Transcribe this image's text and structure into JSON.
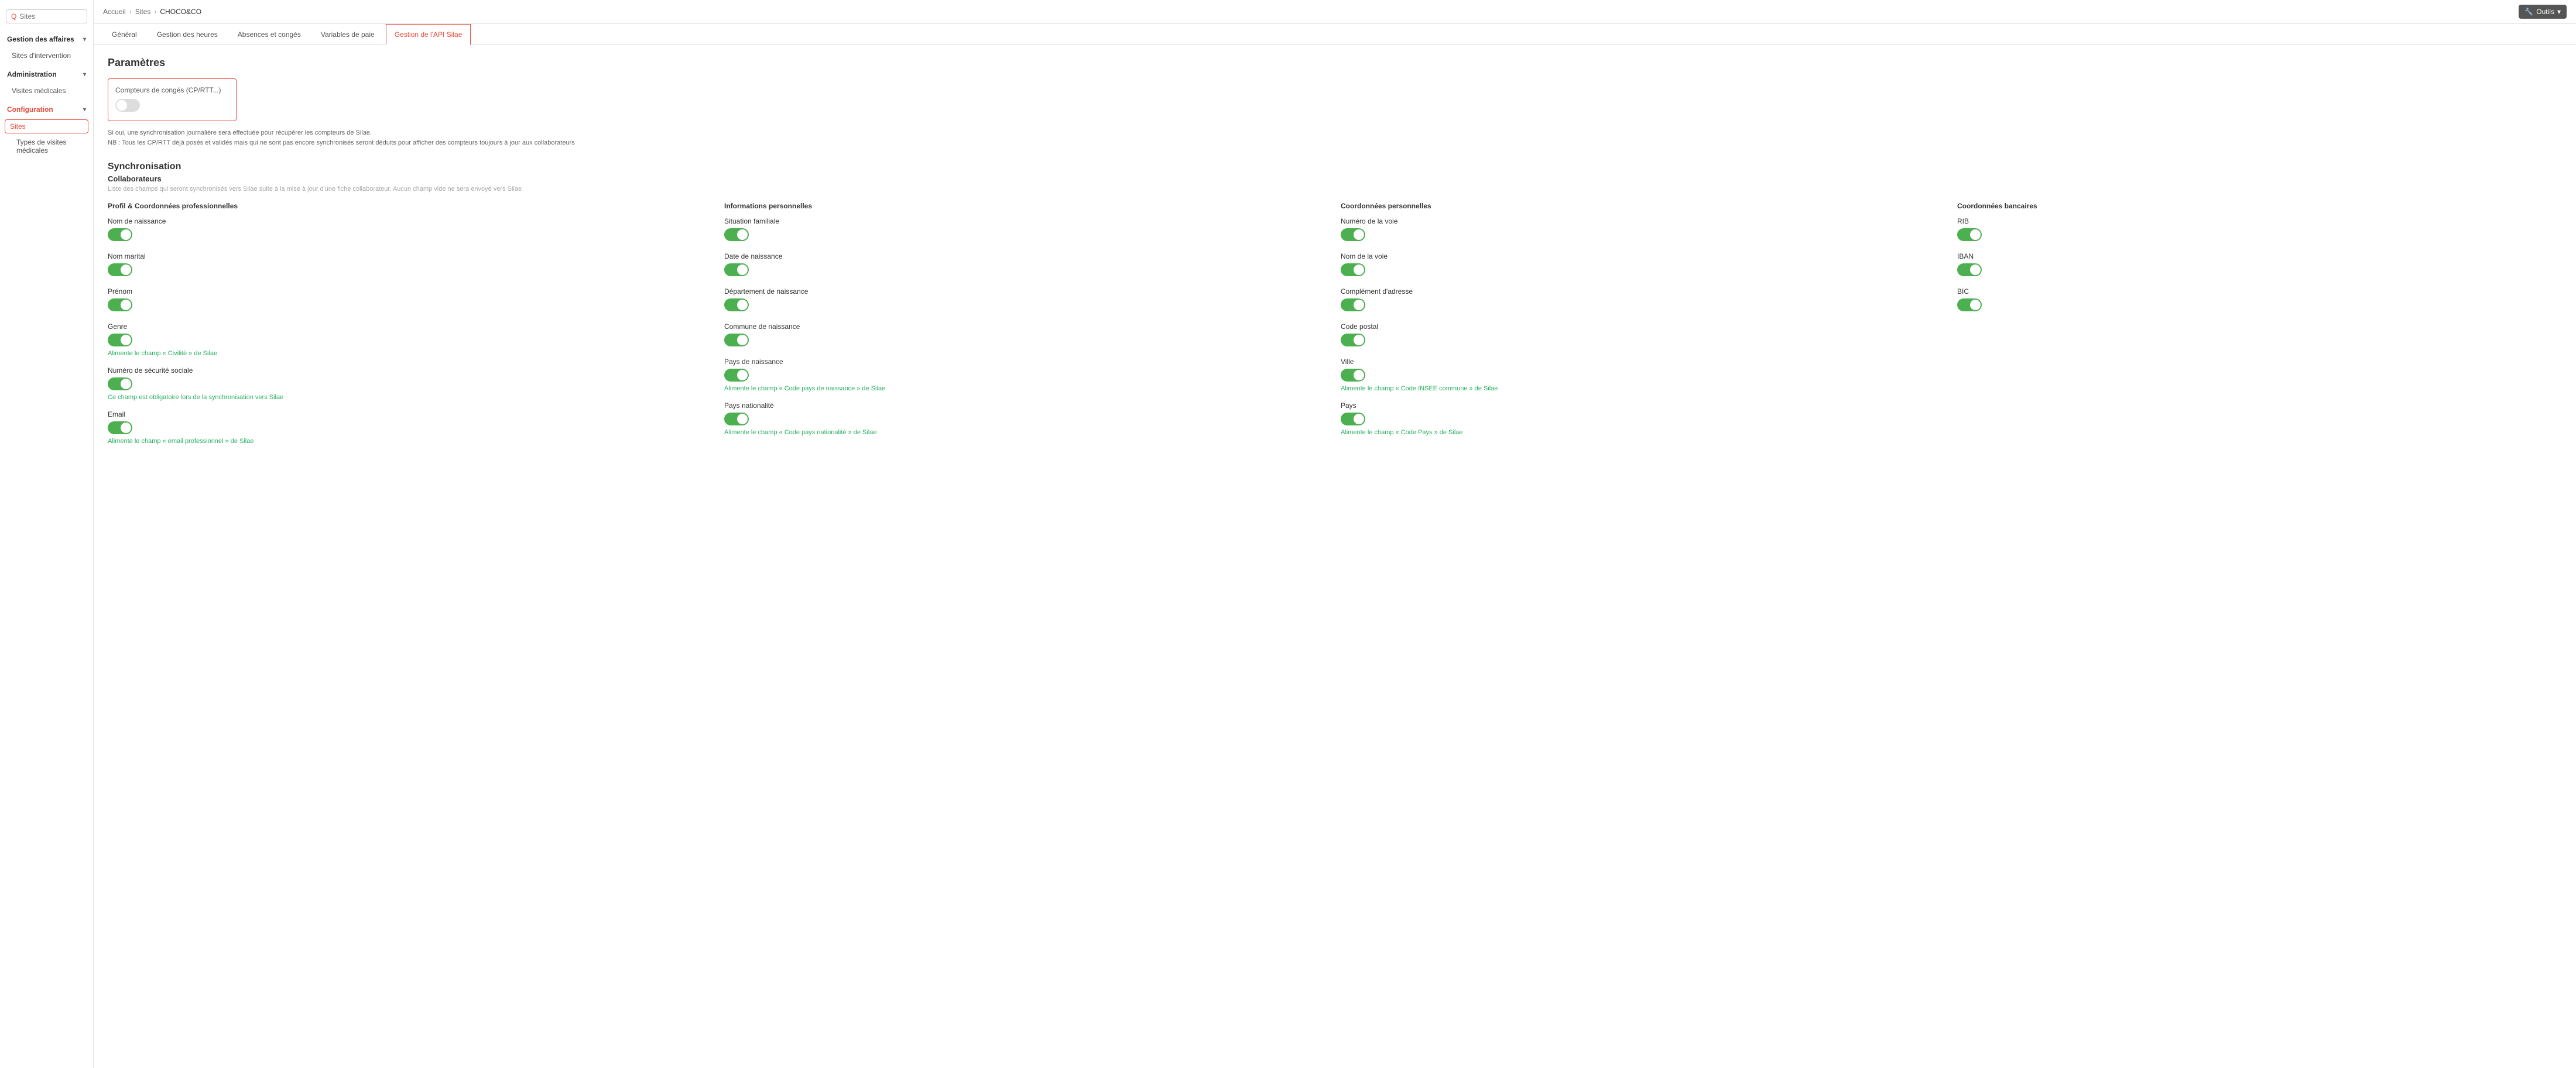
{
  "sidebar": {
    "search_placeholder": "Sites",
    "sections": [
      {
        "label": "Gestion des affaires",
        "color": "default",
        "items": [
          {
            "label": "Sites d'intervention",
            "active": false,
            "sub": false
          }
        ]
      },
      {
        "label": "Administration",
        "color": "default",
        "items": [
          {
            "label": "Visites médicales",
            "active": false,
            "sub": false
          }
        ]
      },
      {
        "label": "Configuration",
        "color": "red",
        "items": [
          {
            "label": "Sites",
            "active": true,
            "sub": false
          },
          {
            "label": "Types de visites médicales",
            "active": false,
            "sub": true
          }
        ]
      }
    ]
  },
  "topbar": {
    "breadcrumb": [
      "Accueil",
      "Sites",
      "CHOCO&CO"
    ],
    "tools_label": "Outils"
  },
  "tabs": [
    {
      "label": "Général",
      "active": false
    },
    {
      "label": "Gestion des heures",
      "active": false
    },
    {
      "label": "Absences et congés",
      "active": false
    },
    {
      "label": "Variables de paie",
      "active": false
    },
    {
      "label": "Gestion de l'API Silae",
      "active": true
    }
  ],
  "content": {
    "params_title": "Paramètres",
    "param_box": {
      "title": "Compteurs de congés (CP/RTT...)",
      "toggle_on": false
    },
    "params_note_line1": "Si oui, une synchronisation journalière sera effectuée pour récupérer les compteurs de Silae.",
    "params_note_line2": "NB : Tous les CP/RTT déjà posés et validés mais qui ne sont pas encore synchronisés seront déduits pour afficher des compteurs toujours à jour aux collaborateurs",
    "sync_title": "Synchronisation",
    "collab_title": "Collaborateurs",
    "collab_note": "Liste des champs qui seront synchronisés vers Silae suite à la mise à jour d'une fiche collaborateur. Aucun champ vide ne sera envoyé vers Silae",
    "columns": [
      {
        "header": "Profil & Coordonnées professionnelles",
        "fields": [
          {
            "label": "Nom de naissance",
            "toggle": true,
            "note": ""
          },
          {
            "label": "Nom marital",
            "toggle": true,
            "note": ""
          },
          {
            "label": "Prénom",
            "toggle": true,
            "note": ""
          },
          {
            "label": "Genre",
            "toggle": true,
            "note": "Alimente le champ « Civilité » de Silae"
          },
          {
            "label": "Numéro de sécurité sociale",
            "toggle": true,
            "note": "Ce champ est obligatoire lors de la synchronisation vers Silae"
          },
          {
            "label": "Email",
            "toggle": true,
            "note": "Alimente le champ « email professionnel » de Silae"
          }
        ]
      },
      {
        "header": "Informations personnelles",
        "fields": [
          {
            "label": "Situation familiale",
            "toggle": true,
            "note": ""
          },
          {
            "label": "Date de naissance",
            "toggle": true,
            "note": ""
          },
          {
            "label": "Département de naissance",
            "toggle": true,
            "note": ""
          },
          {
            "label": "Commune de naissance",
            "toggle": true,
            "note": ""
          },
          {
            "label": "Pays de naissance",
            "toggle": true,
            "note": "Alimente le champ « Code pays de naissance » de Silae"
          },
          {
            "label": "Pays nationalité",
            "toggle": true,
            "note": "Alimente le champ « Code pays nationalité » de Silae"
          }
        ]
      },
      {
        "header": "Coordonnées personnelles",
        "fields": [
          {
            "label": "Numéro de la voie",
            "toggle": true,
            "note": ""
          },
          {
            "label": "Nom de la voie",
            "toggle": true,
            "note": ""
          },
          {
            "label": "Complément d'adresse",
            "toggle": true,
            "note": ""
          },
          {
            "label": "Code postal",
            "toggle": true,
            "note": ""
          },
          {
            "label": "Ville",
            "toggle": true,
            "note": "Alimente le champ « Code INSEE commune » de Silae"
          },
          {
            "label": "Pays",
            "toggle": true,
            "note": "Alimente le champ « Code Pays » de Silae"
          }
        ]
      },
      {
        "header": "Coordonnées bancaires",
        "fields": [
          {
            "label": "RIB",
            "toggle": true,
            "note": ""
          },
          {
            "label": "IBAN",
            "toggle": true,
            "note": ""
          },
          {
            "label": "BIC",
            "toggle": true,
            "note": ""
          }
        ]
      }
    ]
  }
}
